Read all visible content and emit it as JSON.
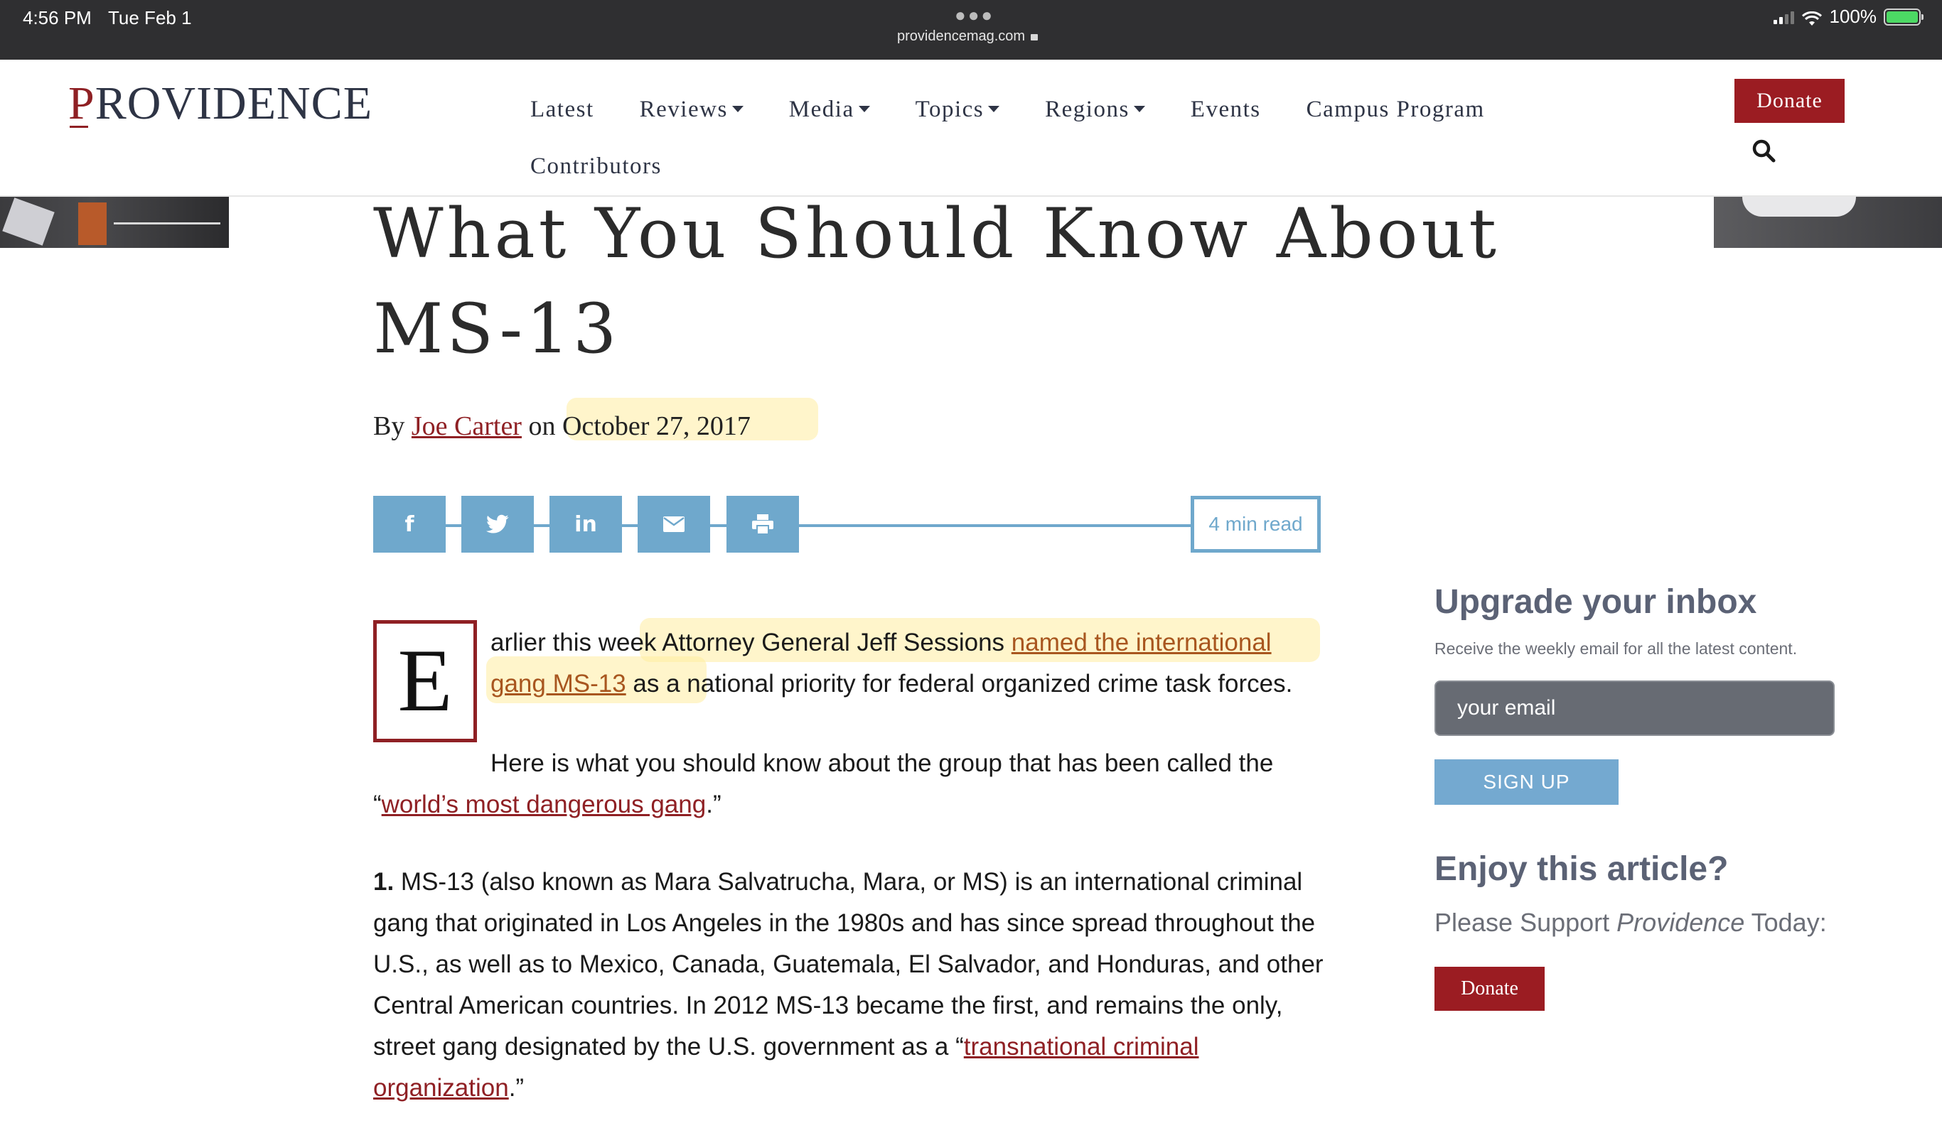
{
  "status_bar": {
    "time": "4:56 PM",
    "date": "Tue Feb 1",
    "url": "providencemag.com",
    "battery": "100%"
  },
  "header": {
    "logo_first": "P",
    "logo_rest": "ROVIDENCE",
    "nav": {
      "latest": "Latest",
      "reviews": "Reviews",
      "media": "Media",
      "topics": "Topics",
      "regions": "Regions",
      "events": "Events",
      "campus": "Campus Program",
      "contributors": "Contributors"
    },
    "donate": "Donate"
  },
  "article": {
    "title_line1": "What You Should Know About",
    "title_line2": "MS-13",
    "by": "By",
    "author": "Joe Carter",
    "on": "on",
    "date": "October 27, 2017",
    "read_time": "4 min read",
    "dropcap": "E",
    "p1_a": "arlier this week Attorney General Jeff Sessions ",
    "p1_link": "named the international gang MS-13",
    "p1_b": " as a national priority for federal organized crime task forces.",
    "p2_a": "Here is what you should know about the group that has been called the",
    "p2_quote_open": "“",
    "p2_link": "world’s most dangerous gang",
    "p2_end": ".”",
    "p3_num": "1.",
    "p3_text": " MS-13 (also known as Mara Salvatrucha, Mara, or MS) is an international criminal gang that originated in Los Angeles in the 1980s and has since spread throughout the U.S., as well as to Mexico, Canada, Guatemala, El Salvador, and Honduras, and other Central American countries. In 2012 MS-13 became the first, and remains the only, street gang designated by the U.S. government as a “",
    "p3_link": "transnational criminal organization",
    "p3_end": ".”"
  },
  "share": {
    "facebook": "f",
    "linkedin": "in"
  },
  "sidebar": {
    "newsletter_title": "Upgrade your inbox",
    "newsletter_sub": "Receive the weekly email for all the latest content.",
    "email_placeholder": "your email",
    "signup": "SIGN UP",
    "enjoy_title": "Enjoy this article?",
    "support_a": "Please Support ",
    "support_em": "Providence",
    "support_b": " Today:",
    "donate": "Donate"
  },
  "colors": {
    "brand_red": "#9b1c22",
    "share_blue": "#6fa8cc",
    "highlight": "#ffeca0"
  }
}
